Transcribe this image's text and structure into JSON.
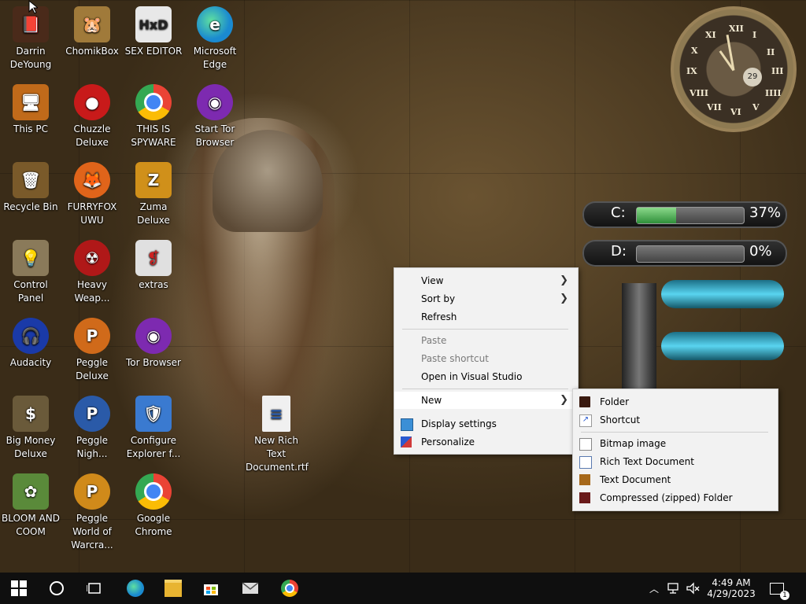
{
  "desktop_icons": [
    {
      "label": "Darrin DeYoung",
      "icon": "book-figure-icon",
      "color": "#4a2a1a"
    },
    {
      "label": "This PC",
      "icon": "computer-icon",
      "color": "#c06a1a"
    },
    {
      "label": "Recycle Bin",
      "icon": "recycle-bin-icon",
      "color": "#7a5a2a"
    },
    {
      "label": "Control Panel",
      "icon": "lightbulb-icon",
      "color": "#8a7a5a"
    },
    {
      "label": "Audacity",
      "icon": "headphones-icon",
      "color": "#1a3aa8"
    },
    {
      "label": "Big Money Deluxe",
      "icon": "money-bag-icon",
      "color": "#6a5a3a"
    },
    {
      "label": "BLOOM AND COOM",
      "icon": "flower-icon",
      "color": "#5a8a3a"
    },
    {
      "label": "ChomikBox",
      "icon": "hamster-box-icon",
      "color": "#a07a3a"
    },
    {
      "label": "Chuzzle Deluxe",
      "icon": "chuzzle-icon",
      "color": "#c81a1a"
    },
    {
      "label": "FURRYFOX UWU",
      "icon": "firefox-icon",
      "color": "#e0641a"
    },
    {
      "label": "Heavy Weap...",
      "icon": "radiation-icon",
      "color": "#b01818"
    },
    {
      "label": "Peggle Deluxe",
      "icon": "peggle-icon",
      "color": "#d06a1a"
    },
    {
      "label": "Peggle Nigh...",
      "icon": "peggle-night-icon",
      "color": "#2a5aa8"
    },
    {
      "label": "Peggle World of Warcra...",
      "icon": "peggle-wow-icon",
      "color": "#d08a1a"
    },
    {
      "label": "SEX EDITOR",
      "icon": "hxd-icon",
      "color": "#e8e8e8"
    },
    {
      "label": "THIS IS SPYWARE",
      "icon": "chrome-icon",
      "color": "#34a853"
    },
    {
      "label": "Zuma Deluxe",
      "icon": "zuma-icon",
      "color": "#d0901a"
    },
    {
      "label": "extras",
      "icon": "file-icon",
      "color": "#e0e0e0"
    },
    {
      "label": "Tor Browser",
      "icon": "tor-icon",
      "color": "#7d2ab0"
    },
    {
      "label": "Configure Explorer f...",
      "icon": "shield-icon",
      "color": "#3a7ad0"
    },
    {
      "label": "Google Chrome",
      "icon": "chrome-icon",
      "color": "#34a853"
    },
    {
      "label": "Microsoft Edge",
      "icon": "edge-icon",
      "color": "#1a8ad0"
    },
    {
      "label": "Start Tor Browser",
      "icon": "tor-icon",
      "color": "#7d2ab0"
    },
    {
      "label": "New Rich Text Document.rtf",
      "icon": "rtf-document-icon",
      "color": "#f0f0f0"
    }
  ],
  "clock_widget": {
    "numerals": [
      "XII",
      "I",
      "II",
      "III",
      "IIII",
      "V",
      "VI",
      "VII",
      "VIII",
      "IX",
      "X",
      "XI"
    ],
    "date": "29"
  },
  "drives": [
    {
      "label": "C:",
      "percent": "37%",
      "fill": 0.37
    },
    {
      "label": "D:",
      "percent": "0%",
      "fill": 0.0
    }
  ],
  "context_menu": {
    "items": [
      {
        "label": "View",
        "submenu": true,
        "disabled": false
      },
      {
        "label": "Sort by",
        "submenu": true,
        "disabled": false
      },
      {
        "label": "Refresh",
        "submenu": false,
        "disabled": false
      },
      {
        "label": "Paste",
        "submenu": false,
        "disabled": true
      },
      {
        "label": "Paste shortcut",
        "submenu": false,
        "disabled": true
      },
      {
        "label": "Open in Visual Studio",
        "submenu": false,
        "disabled": false
      },
      {
        "label": "New",
        "submenu": true,
        "disabled": false,
        "highlighted": true
      },
      {
        "label": "Display settings",
        "icon": "display-icon",
        "submenu": false,
        "disabled": false
      },
      {
        "label": "Personalize",
        "icon": "personalize-icon",
        "submenu": false,
        "disabled": false
      }
    ]
  },
  "new_submenu": {
    "items": [
      {
        "label": "Folder",
        "icon": "folder-icon"
      },
      {
        "label": "Shortcut",
        "icon": "shortcut-icon"
      },
      {
        "label": "Bitmap image",
        "icon": "bitmap-icon"
      },
      {
        "label": "Rich Text Document",
        "icon": "rich-text-icon"
      },
      {
        "label": "Text Document",
        "icon": "text-document-icon"
      },
      {
        "label": "Compressed (zipped) Folder",
        "icon": "zip-folder-icon"
      }
    ]
  },
  "taskbar": {
    "apps": [
      {
        "name": "edge-taskbar-icon",
        "color": "#1a8ad0"
      },
      {
        "name": "file-explorer-icon",
        "color": "#e8b431"
      },
      {
        "name": "store-icon",
        "color": "#0a78d4"
      },
      {
        "name": "mail-icon",
        "color": "#dddddd"
      },
      {
        "name": "chrome-taskbar-icon",
        "color": "#34a853"
      }
    ],
    "time": "4:49 AM",
    "date": "4/29/2023",
    "notification_count": "1"
  }
}
